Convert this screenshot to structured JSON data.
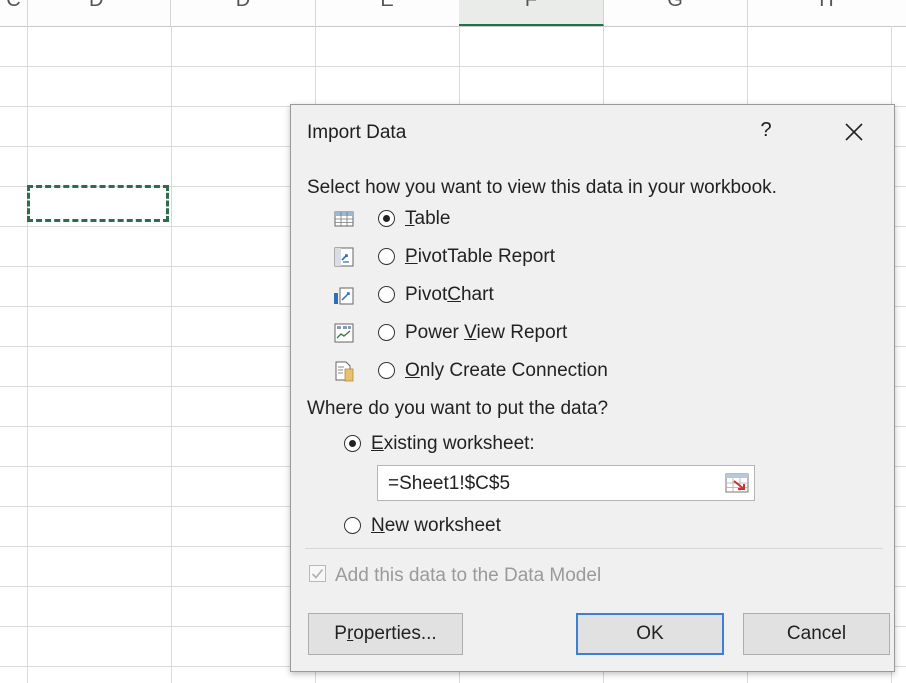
{
  "sheet": {
    "columns": [
      "C",
      "D",
      "E",
      "F",
      "G",
      "H"
    ],
    "selected_column": "F"
  },
  "dialog": {
    "title": "Import Data",
    "help_label": "?",
    "close_label": "✕",
    "view_prompt": "Select how you want to view this data in your workbook.",
    "view_options": [
      {
        "label": "Table",
        "underline": "T",
        "rest": "able",
        "selected": true,
        "icon": "table-icon"
      },
      {
        "label": "PivotTable Report",
        "underline": "P",
        "rest": "ivotTable Report",
        "selected": false,
        "icon": "pivottable-icon"
      },
      {
        "label": "PivotChart",
        "prefix": "Pivot",
        "underline": "C",
        "rest": "hart",
        "selected": false,
        "icon": "pivotchart-icon"
      },
      {
        "label": "Power View Report",
        "prefix": "Power ",
        "underline": "V",
        "rest": "iew Report",
        "selected": false,
        "icon": "powerview-icon"
      },
      {
        "label": "Only Create Connection",
        "underline": "O",
        "rest": "nly Create Connection",
        "selected": false,
        "icon": "connection-icon"
      }
    ],
    "location_prompt": "Where do you want to put the data?",
    "existing_worksheet": {
      "underline": "E",
      "rest": "xisting worksheet:",
      "selected": true
    },
    "location_value": "=Sheet1!$C$5",
    "new_worksheet": {
      "underline": "N",
      "rest": "ew worksheet",
      "selected": false
    },
    "data_model_label": "Add this data to the Data Model",
    "data_model_checked": true,
    "properties_button": {
      "prefix": "P",
      "underline": "r",
      "rest": "operties..."
    },
    "ok_button": "OK",
    "cancel_button": "Cancel"
  }
}
